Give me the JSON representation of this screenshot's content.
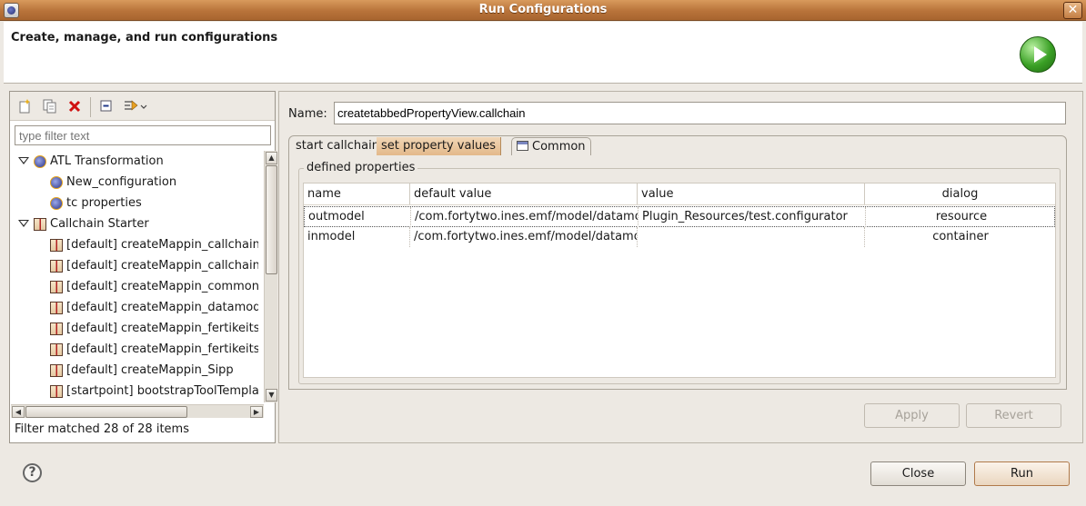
{
  "window": {
    "title": "Run Configurations"
  },
  "banner": {
    "heading": "Create, manage, and run configurations"
  },
  "toolbar": {
    "icons": [
      "new-config-icon",
      "duplicate-icon",
      "delete-icon",
      "collapse-all-icon",
      "filter-icon"
    ]
  },
  "filter": {
    "placeholder": "type filter text"
  },
  "tree": {
    "rows": [
      {
        "label": "ATL Transformation",
        "type": "category"
      },
      {
        "label": "New_configuration",
        "type": "atl"
      },
      {
        "label": "tc properties",
        "type": "atl"
      },
      {
        "label": "Callchain Starter",
        "type": "category"
      },
      {
        "label": "[default] createMappin_callchain",
        "type": "chain"
      },
      {
        "label": "[default] createMappin_callchain",
        "type": "chain"
      },
      {
        "label": "[default] createMappin_common",
        "type": "chain"
      },
      {
        "label": "[default] createMappin_datamod",
        "type": "chain"
      },
      {
        "label": "[default] createMappin_fertikeits",
        "type": "chain"
      },
      {
        "label": "[default] createMappin_fertikeits",
        "type": "chain"
      },
      {
        "label": "[default] createMappin_Sipp",
        "type": "chain"
      },
      {
        "label": "[startpoint] bootstrapToolTempla",
        "type": "chain"
      }
    ]
  },
  "filter_status": "Filter matched 28 of 28 items",
  "name_field": {
    "label": "Name:",
    "value": "createtabbedPropertyView.callchain"
  },
  "tabs": [
    {
      "label": "start callchain"
    },
    {
      "label": "set property values"
    },
    {
      "label": "Common"
    }
  ],
  "group": {
    "label": "defined properties"
  },
  "table": {
    "columns": [
      "name",
      "default value",
      "value",
      "dialog"
    ],
    "rows": [
      {
        "name": "outmodel",
        "default_value": "/com.fortytwo.ines.emf/model/datamo",
        "value": "Plugin_Resources/test.configurator",
        "dialog": "resource"
      },
      {
        "name": "inmodel",
        "default_value": "/com.fortytwo.ines.emf/model/datamo",
        "value": "",
        "dialog": "container"
      }
    ]
  },
  "buttons": {
    "apply": "Apply",
    "revert": "Revert",
    "close": "Close",
    "run": "Run"
  },
  "help": "?"
}
